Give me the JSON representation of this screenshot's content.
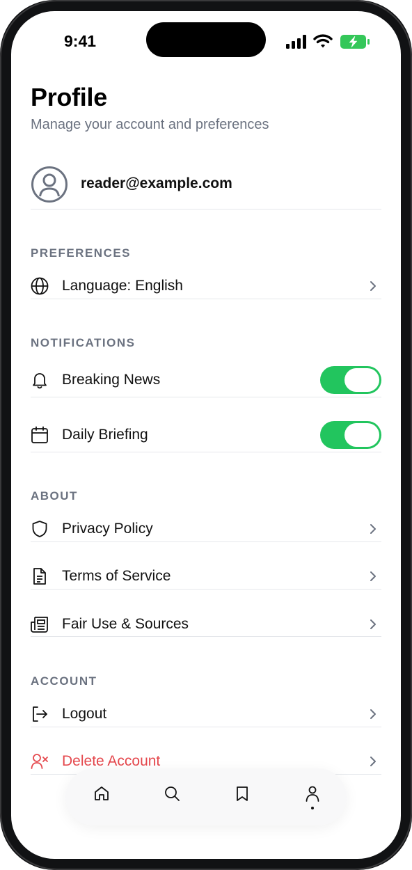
{
  "status_bar": {
    "time": "9:41"
  },
  "header": {
    "title": "Profile",
    "subtitle": "Manage your account and preferences"
  },
  "user": {
    "email": "reader@example.com"
  },
  "sections": {
    "preferences": {
      "title": "PREFERENCES",
      "language_label": "Language: English"
    },
    "notifications": {
      "title": "NOTIFICATIONS",
      "breaking_news": {
        "label": "Breaking News",
        "enabled": true
      },
      "daily_briefing": {
        "label": "Daily Briefing",
        "enabled": true
      }
    },
    "about": {
      "title": "ABOUT",
      "privacy": "Privacy Policy",
      "terms": "Terms of Service",
      "fair_use": "Fair Use & Sources"
    },
    "account": {
      "title": "ACCOUNT",
      "logout": "Logout",
      "delete": "Delete Account"
    }
  },
  "tab_bar": {
    "tabs": [
      "home-icon",
      "search-icon",
      "bookmark-icon",
      "profile-icon"
    ],
    "active": "profile-icon"
  },
  "colors": {
    "accent_green": "#22c55e",
    "danger": "#e5484d",
    "muted": "#6b7280",
    "battery_green": "#34c759"
  }
}
